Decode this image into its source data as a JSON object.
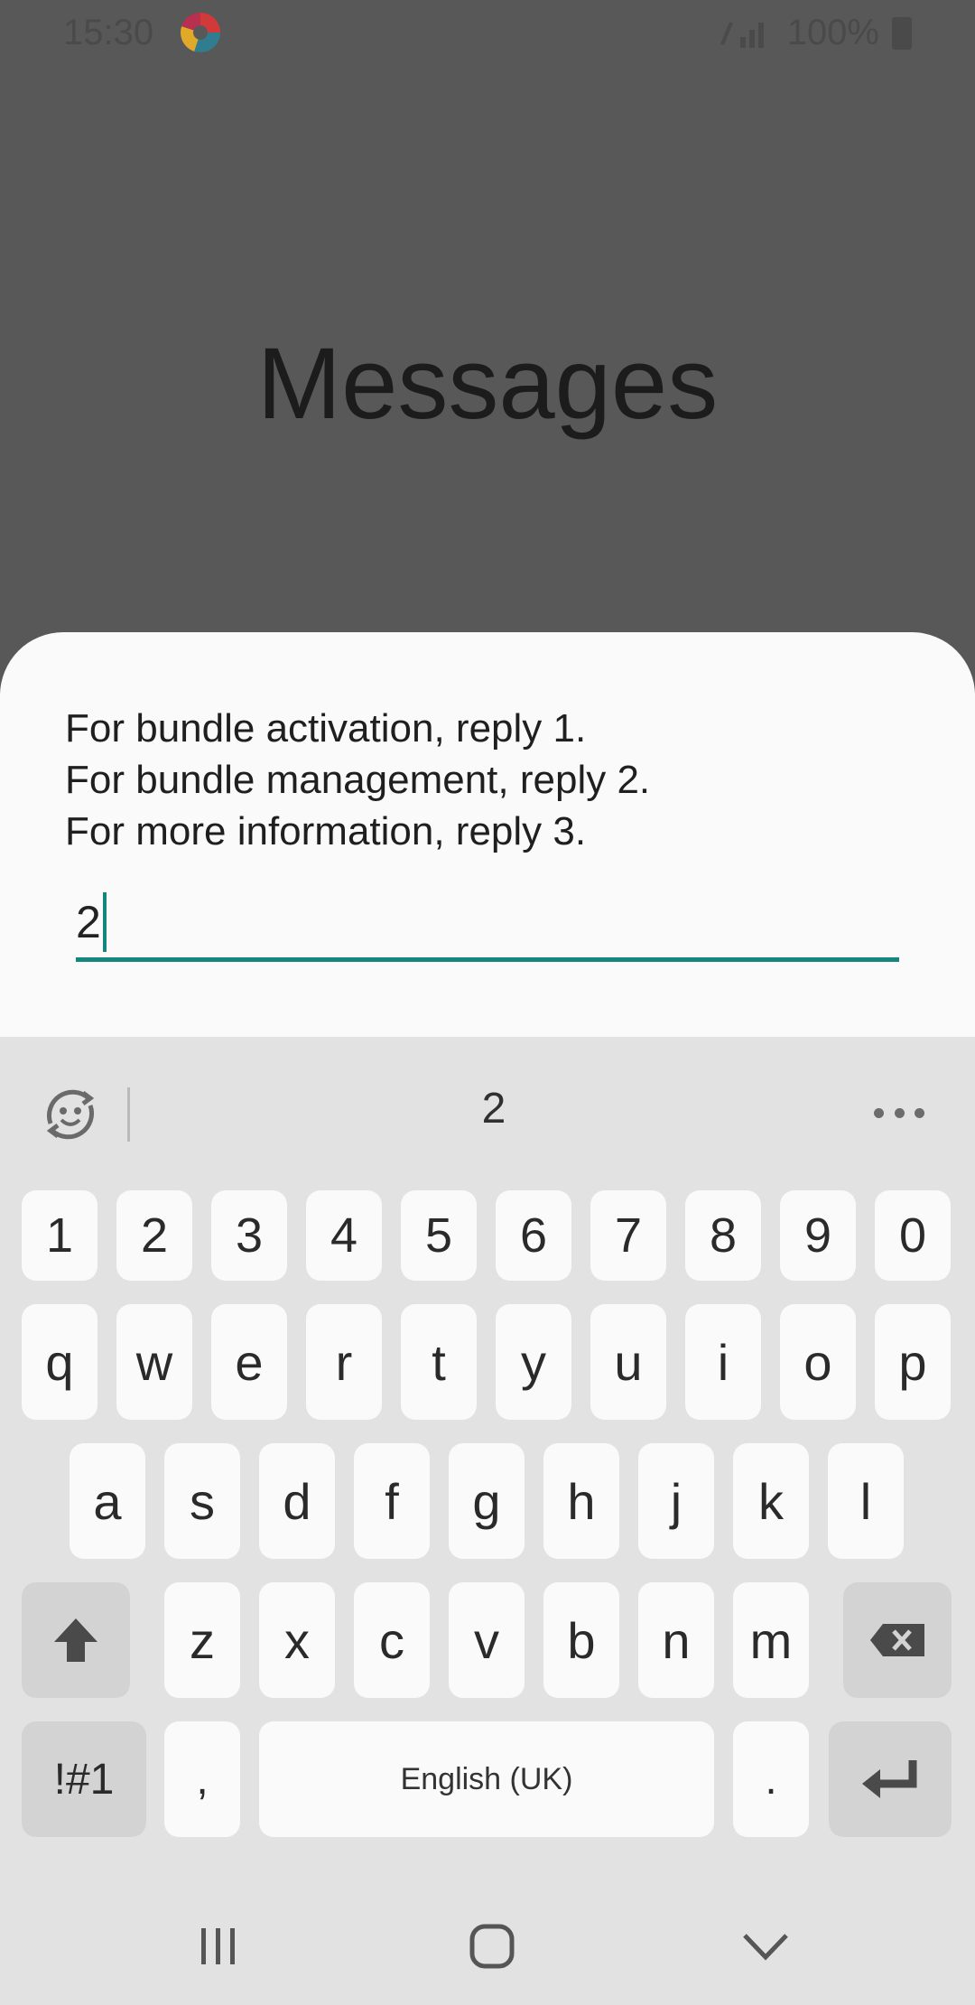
{
  "status": {
    "time": "15:30",
    "battery": "100%"
  },
  "app": {
    "title": "Messages"
  },
  "dialog": {
    "lines": [
      "For bundle activation, reply 1.",
      "For bundle management, reply 2.",
      "For more information, reply 3."
    ],
    "input_value": "2"
  },
  "keyboard": {
    "suggestion": "2",
    "row_numbers": [
      "1",
      "2",
      "3",
      "4",
      "5",
      "6",
      "7",
      "8",
      "9",
      "0"
    ],
    "row1": [
      "q",
      "w",
      "e",
      "r",
      "t",
      "y",
      "u",
      "i",
      "o",
      "p"
    ],
    "row2": [
      "a",
      "s",
      "d",
      "f",
      "g",
      "h",
      "j",
      "k",
      "l"
    ],
    "row3": [
      "z",
      "x",
      "c",
      "v",
      "b",
      "n",
      "m"
    ],
    "symbols_label": "!#1",
    "comma": ",",
    "space_label": "English (UK)",
    "period": "."
  },
  "icons": {
    "emoji": "emoji-icon",
    "more": "more-icon",
    "shift": "shift-icon",
    "backspace": "backspace-icon",
    "enter": "enter-icon",
    "recents": "recents-icon",
    "home": "home-icon",
    "back": "back-icon"
  },
  "colors": {
    "accent": "#14867f",
    "scrim": "#585858",
    "sheet": "#fafafa",
    "keyboard": "#e2e2e2"
  }
}
